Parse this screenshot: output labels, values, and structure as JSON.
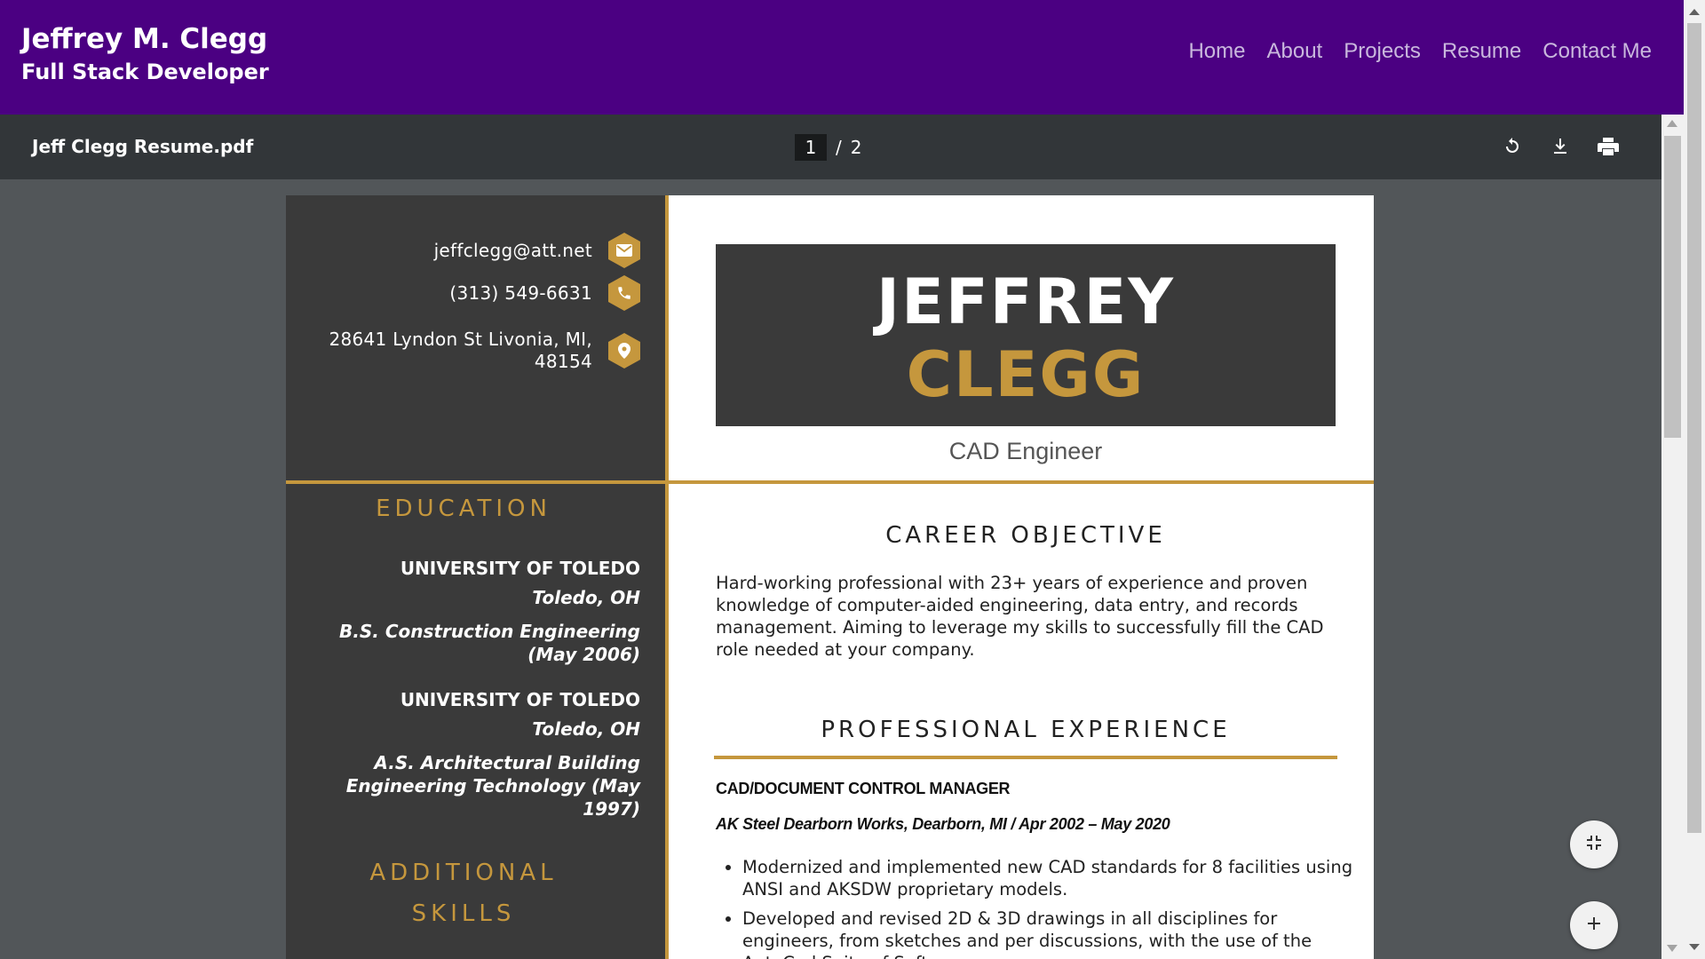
{
  "site": {
    "name": "Jeffrey M. Clegg",
    "tagline": "Full Stack Developer",
    "nav": [
      "Home",
      "About",
      "Projects",
      "Resume",
      "Contact Me"
    ]
  },
  "pdf": {
    "file_name": "Jeff Clegg Resume.pdf",
    "current_page": "1",
    "separator": "/",
    "total_pages": "2",
    "toolbar_icons": [
      "rotate-icon",
      "download-icon",
      "print-icon"
    ],
    "fab_icons": [
      "fit-page-icon",
      "zoom-in-icon"
    ]
  },
  "resume": {
    "contact": {
      "email": "jeffclegg@att.net",
      "phone": "(313) 549-6631",
      "address_line1": "28641 Lyndon St Livonia, MI,",
      "address_line2": "48154"
    },
    "education_heading": "EDUCATION",
    "education": [
      {
        "school": "UNIVERSITY OF TOLEDO",
        "location": "Toledo, OH",
        "degree_line1": "B.S. Construction Engineering",
        "degree_line2": "(May 2006)"
      },
      {
        "school": "UNIVERSITY OF TOLEDO",
        "location": "Toledo, OH",
        "degree_line1": "A.S. Architectural Building",
        "degree_line2": "Engineering Technology (May",
        "degree_line3": "1997)"
      }
    ],
    "skills_heading_line1": "ADDITIONAL",
    "skills_heading_line2": "SKILLS",
    "first_name": "JEFFREY",
    "last_name": "CLEGG",
    "role": "CAD Engineer",
    "objective_heading": "CAREER OBJECTIVE",
    "objective": "Hard-working professional with 23+ years of experience and proven knowledge of computer-aided engineering, data entry, and records management. Aiming to leverage my skills to successfully fill the CAD role needed at your company.",
    "experience_heading": "PROFESSIONAL EXPERIENCE",
    "job_title": "CAD/DOCUMENT CONTROL MANAGER",
    "job_company": "AK Steel Dearborn Works, Dearborn, MI / Apr 2002 – May 2020",
    "bullets": [
      "Modernized and implemented new CAD standards for 8 facilities using ANSI and AKSDW proprietary models.",
      "Developed and revised 2D & 3D drawings in all disciplines for engineers, from sketches and per discussions, with the use of the AutoCad Suite of Software."
    ]
  },
  "colors": {
    "header_bg": "#4b0082",
    "toolbar_bg": "#323639",
    "viewer_bg": "#525659",
    "resume_dark": "#3a3a3a",
    "resume_gold": "#c5973d"
  }
}
